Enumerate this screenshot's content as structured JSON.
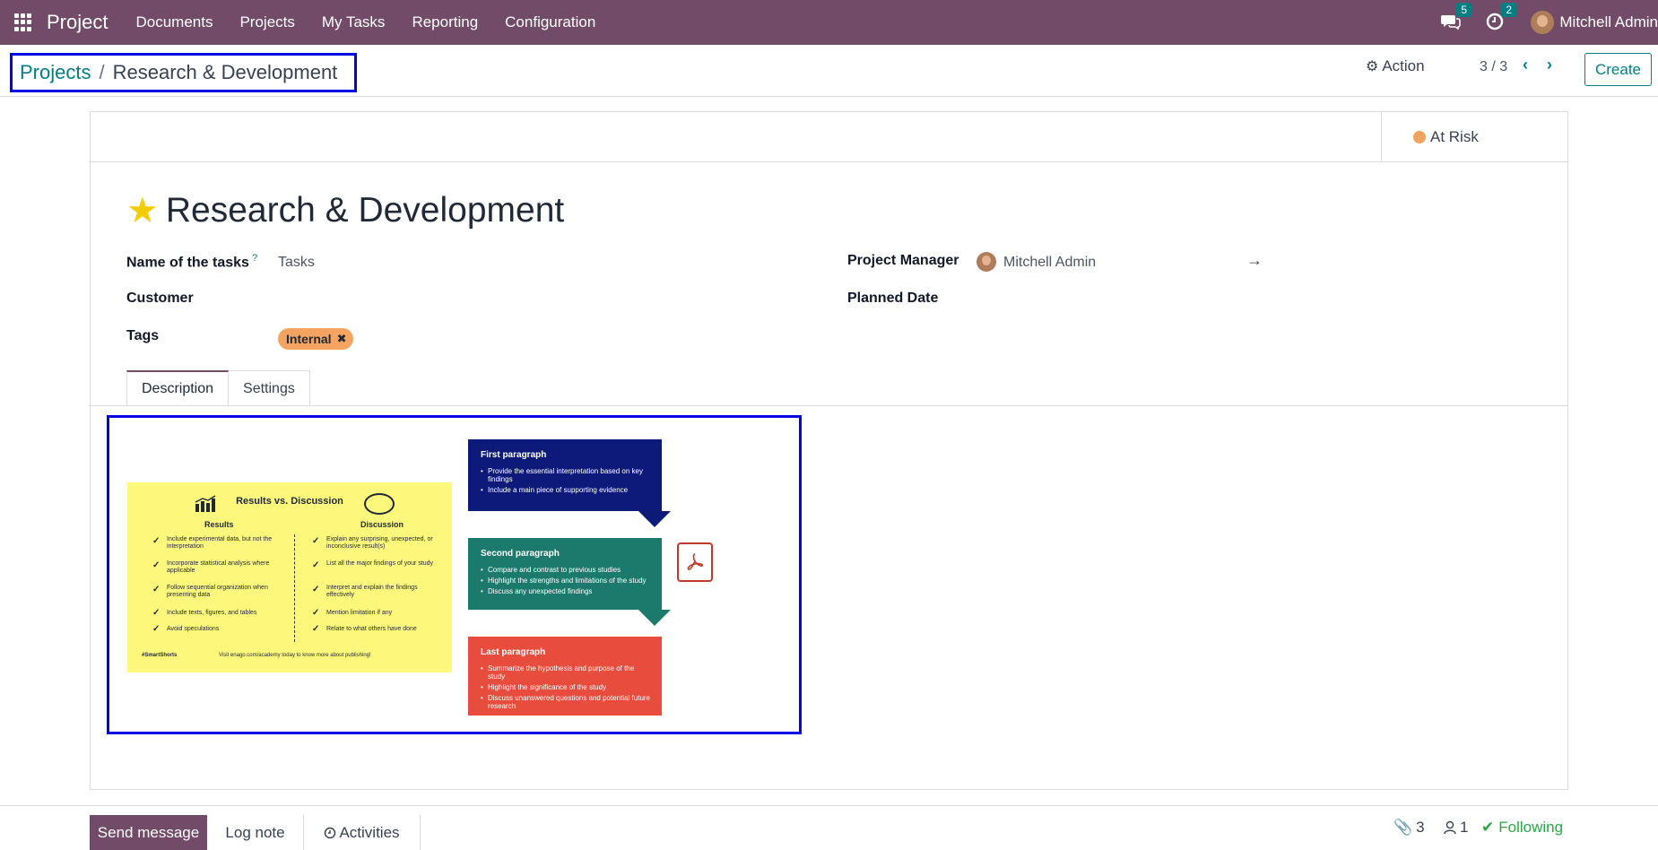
{
  "navbar": {
    "brand": "Project",
    "menu": [
      "Documents",
      "Projects",
      "My Tasks",
      "Reporting",
      "Configuration"
    ],
    "messages_count": "5",
    "activities_count": "2",
    "user_name": "Mitchell Admin",
    "bg_color": "#714b67"
  },
  "breadcrumb": {
    "parent": "Projects",
    "separator": "/",
    "current": "Research & Development"
  },
  "control": {
    "action_label": "Action",
    "pager": "3 / 3",
    "create_label": "Create"
  },
  "status": {
    "label": "At Risk",
    "color": "#f0a35e"
  },
  "record": {
    "title": "Research & Development",
    "favorite": true,
    "fields": {
      "task_name_label": "Name of the tasks",
      "task_name_help": "?",
      "task_name_value": "Tasks",
      "customer_label": "Customer",
      "customer_value": "",
      "tags_label": "Tags",
      "tag": "Internal",
      "manager_label": "Project Manager",
      "manager_value": "Mitchell Admin",
      "planned_label": "Planned Date",
      "planned_arrow": "→"
    }
  },
  "tabs": [
    "Description",
    "Settings"
  ],
  "description_image": {
    "yellow": {
      "title": "Results vs. Discussion",
      "results_header": "Results",
      "discussion_header": "Discussion",
      "results": [
        "Include experimental data, but not the interpretation",
        "Incorporate statistical analysis where applicable",
        "Follow sequential organization when presenting data",
        "Include texts, figures, and tables",
        "Avoid speculations"
      ],
      "discussion": [
        "Explain any surprising, unexpected, or inconclusive result(s)",
        "List all the major findings of your study",
        "Interpret and explain the findings effectively",
        "Mention limitation if any",
        "Relate to what others have done"
      ],
      "footer_left": "#SmartShorts",
      "footer_right": "Visit enago.com/academy today to know more about publishing!"
    },
    "first": {
      "title": "First paragraph",
      "items": [
        "Provide the essential interpretation based on key findings",
        "Include a main piece of supporting evidence"
      ],
      "color": "#0d1a7a"
    },
    "second": {
      "title": "Second paragraph",
      "items": [
        "Compare and contrast to previous studies",
        "Highlight the strengths and limitations of the study",
        "Discuss any unexpected findings"
      ],
      "color": "#1b7a6b"
    },
    "last": {
      "title": "Last paragraph",
      "items": [
        "Summarize the hypothesis and purpose of the study",
        "Highlight the significance of the study",
        "Discuss unanswered questions and potential future research"
      ],
      "color": "#e74c3c"
    }
  },
  "chatter": {
    "send_label": "Send message",
    "log_label": "Log note",
    "activities_label": "Activities",
    "attachments_count": "3",
    "followers_count": "1",
    "following_label": "Following"
  }
}
